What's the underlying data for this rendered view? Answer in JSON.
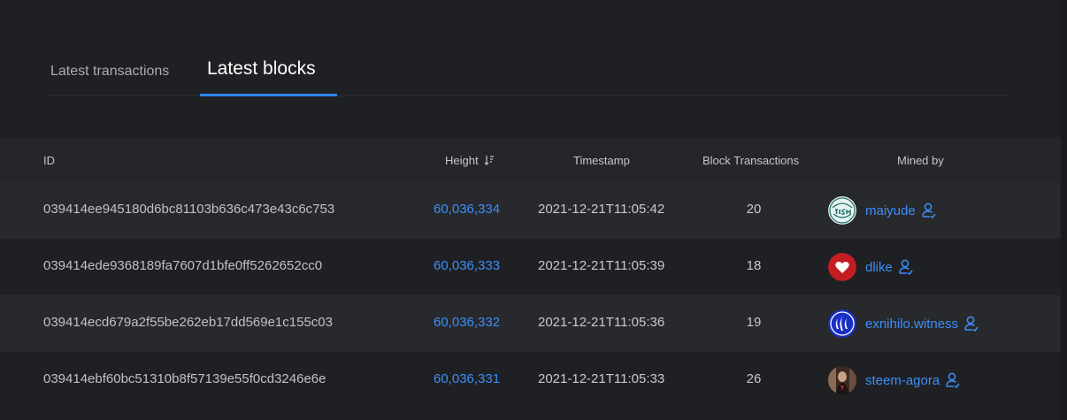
{
  "tabs": {
    "transactions_label": "Latest transactions",
    "blocks_label": "Latest blocks",
    "active": "blocks"
  },
  "table": {
    "headers": {
      "id": "ID",
      "height": "Height",
      "timestamp": "Timestamp",
      "block_transactions": "Block Transactions",
      "mined_by": "Mined by"
    },
    "rows": [
      {
        "id": "039414ee945180d6bc81103b636c473e43c6c753",
        "height": "60,036,334",
        "timestamp": "2021-12-21T11:05:42",
        "transactions": "20",
        "miner": "maiyude",
        "avatar": "fish-logo-avatar"
      },
      {
        "id": "039414ede9368189fa7607d1bfe0ff5262652cc0",
        "height": "60,036,333",
        "timestamp": "2021-12-21T11:05:39",
        "transactions": "18",
        "miner": "dlike",
        "avatar": "heart-avatar"
      },
      {
        "id": "039414ecd679a2f55be262eb17dd569e1c155c03",
        "height": "60,036,332",
        "timestamp": "2021-12-21T11:05:36",
        "transactions": "19",
        "miner": "exnihilo.witness",
        "avatar": "steem-logo-avatar"
      },
      {
        "id": "039414ebf60bc51310b8f57139e55f0cd3246e6e",
        "height": "60,036,331",
        "timestamp": "2021-12-21T11:05:33",
        "transactions": "26",
        "miner": "steem-agora",
        "avatar": "portrait-avatar"
      }
    ]
  },
  "colors": {
    "accent": "#2f86f6",
    "link": "#3d8ef7",
    "background": "#1f2024",
    "row_alt": "#27292d",
    "header_bg": "#24262a"
  },
  "icons": {
    "sort": "sort-descending-icon",
    "user": "user-profile-icon"
  }
}
